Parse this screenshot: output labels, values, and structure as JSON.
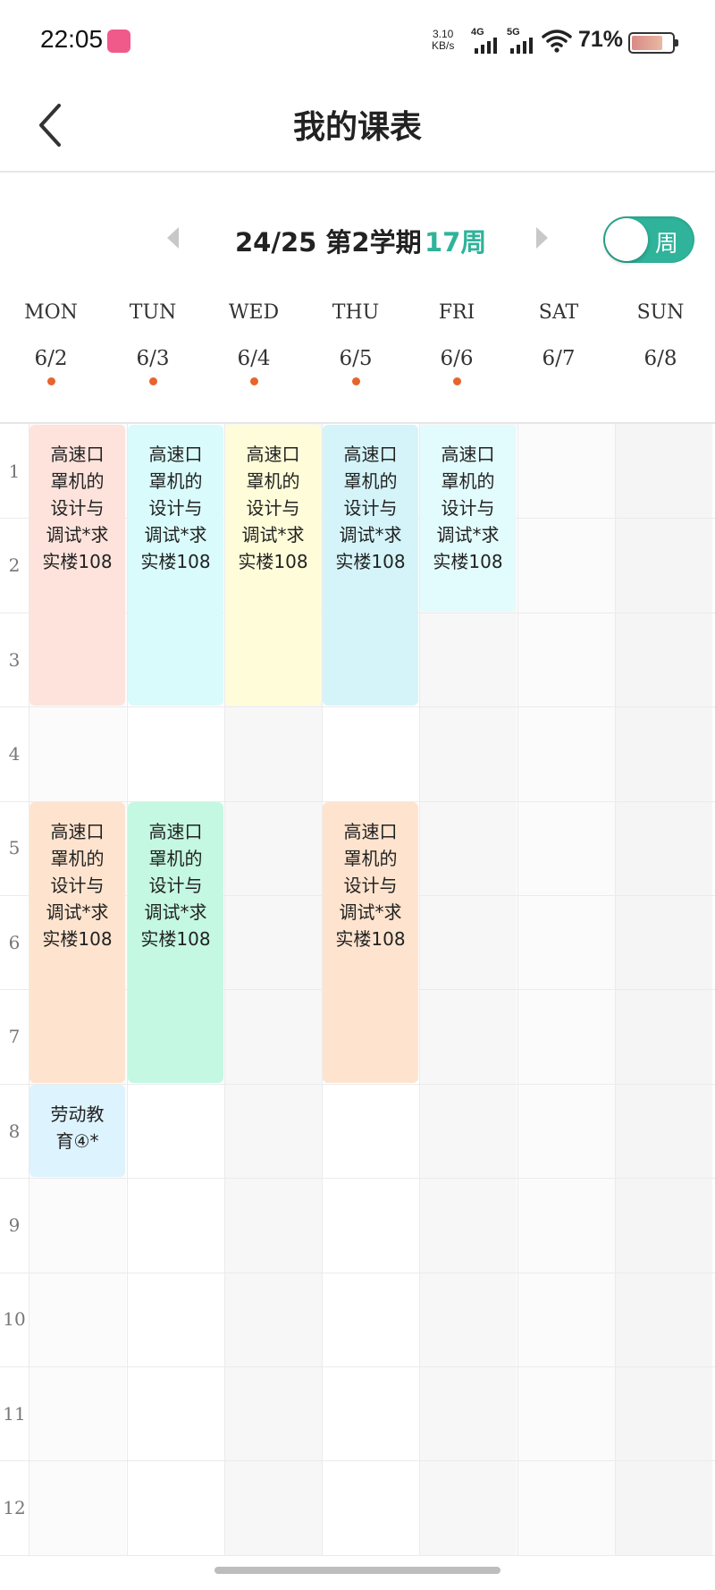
{
  "status_bar": {
    "time": "22:05",
    "net_speed_value": "3.10",
    "net_speed_unit": "KB/s",
    "sig1_label": "4G",
    "sig2_label": "5G",
    "battery_percent": "71%"
  },
  "header": {
    "title": "我的课表"
  },
  "term": {
    "label": "24/25 第2学期",
    "week": "17周",
    "toggle_label": "周"
  },
  "days": [
    {
      "name": "MON",
      "date": "6/2",
      "has_class": true
    },
    {
      "name": "TUN",
      "date": "6/3",
      "has_class": true
    },
    {
      "name": "WED",
      "date": "6/4",
      "has_class": true
    },
    {
      "name": "THU",
      "date": "6/5",
      "has_class": true
    },
    {
      "name": "FRI",
      "date": "6/6",
      "has_class": true
    },
    {
      "name": "SAT",
      "date": "6/7",
      "has_class": false
    },
    {
      "name": "SUN",
      "date": "6/8",
      "has_class": false
    }
  ],
  "periods": [
    "1",
    "2",
    "3",
    "4",
    "5",
    "6",
    "7",
    "8",
    "9",
    "10",
    "11",
    "12"
  ],
  "courses": [
    {
      "day": 0,
      "start": 1,
      "span": 3,
      "name": "高速口罩机的设计与调试*求实楼108",
      "color": "#fde3dc"
    },
    {
      "day": 1,
      "start": 1,
      "span": 3,
      "name": "高速口罩机的设计与调试*求实楼108",
      "color": "#d9fbfb"
    },
    {
      "day": 2,
      "start": 1,
      "span": 3,
      "name": "高速口罩机的设计与调试*求实楼108",
      "color": "#fffdd9"
    },
    {
      "day": 3,
      "start": 1,
      "span": 3,
      "name": "高速口罩机的设计与调试*求实楼108",
      "color": "#d4f4f9"
    },
    {
      "day": 4,
      "start": 1,
      "span": 2,
      "name": "高速口罩机的设计与调试*求实楼108",
      "color": "#e2fbfc"
    },
    {
      "day": 0,
      "start": 5,
      "span": 3,
      "name": "高速口罩机的设计与调试*求实楼108",
      "color": "#fee4cf"
    },
    {
      "day": 1,
      "start": 5,
      "span": 3,
      "name": "高速口罩机的设计与调试*求实楼108",
      "color": "#c4f8e2"
    },
    {
      "day": 3,
      "start": 5,
      "span": 3,
      "name": "高速口罩机的设计与调试*求实楼108",
      "color": "#fee4cf"
    },
    {
      "day": 0,
      "start": 8,
      "span": 1,
      "name": "劳动教育④*",
      "color": "#ddf3fd"
    }
  ]
}
